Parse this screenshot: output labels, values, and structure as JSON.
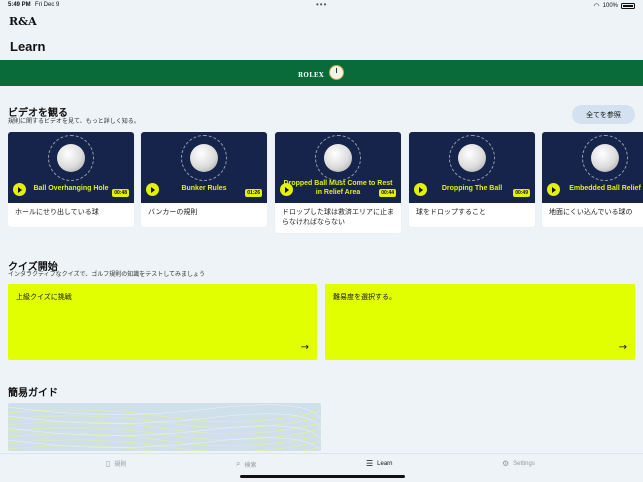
{
  "status": {
    "time": "5:49 PM",
    "date": "Fri Dec 9",
    "battery": "100%"
  },
  "app": {
    "logo": "R&A",
    "title": "Learn"
  },
  "banner": {
    "brand": "ROLEX"
  },
  "videos_section": {
    "title": "ビデオを観る",
    "subtitle": "規則に関するビデオを見て、もっと詳しく知る。",
    "see_all": "全てを参照",
    "items": [
      {
        "title": "Ball Overhanging Hole",
        "duration": "00:48",
        "caption": "ホールにせり出している球"
      },
      {
        "title": "Bunker Rules",
        "duration": "01:26",
        "caption": "バンカーの規則"
      },
      {
        "title": "Dropped Ball Must Come to Rest in Relief Area",
        "duration": "00:44",
        "caption": "ドロップした球は救済エリアに止まらなければならない"
      },
      {
        "title": "Dropping The Ball",
        "duration": "00:49",
        "caption": "球をドロップすること"
      },
      {
        "title": "Embedded Ball Relief",
        "duration": "",
        "caption": "地面にくい込んでいる球の"
      }
    ]
  },
  "quiz_section": {
    "title": "クイズ開始",
    "subtitle": "インタラクティブなクイズで、ゴルフ規則の知識をテストしてみましょう",
    "cards": [
      {
        "label": "上級クイズに挑戦"
      },
      {
        "label": "難易度を選択する。"
      }
    ]
  },
  "guide_section": {
    "title": "簡易ガイド"
  },
  "tabbar": {
    "items": [
      {
        "label": "規則",
        "icon": "book-icon"
      },
      {
        "label": "検索",
        "icon": "search-icon"
      },
      {
        "label": "Learn",
        "icon": "list-icon",
        "active": true
      },
      {
        "label": "Settings",
        "icon": "gear-icon"
      }
    ]
  },
  "colors": {
    "accent": "#e2ff00",
    "banner": "#0a6b3a",
    "thumb_bg": "#16234a"
  }
}
